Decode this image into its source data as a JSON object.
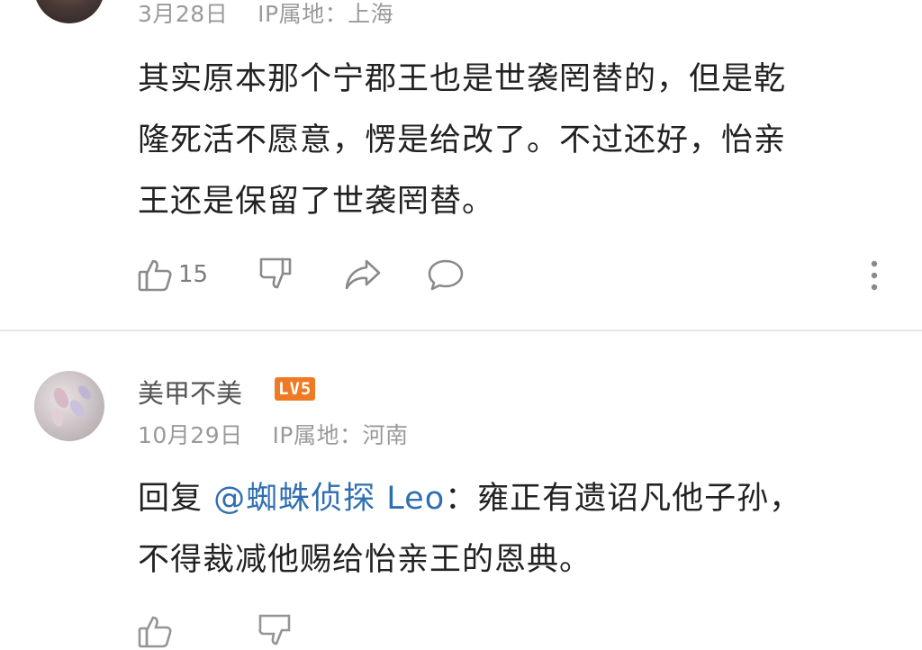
{
  "comment1": {
    "date": "3月28日",
    "ip_label": "IP属地：",
    "ip_location": "上海",
    "lines": [
      "其实原本那个宁郡王也是世袭罔替的，但是乾",
      "隆死活不愿意，愣是给改了。不过还好，怡亲",
      "王还是保留了世袭罔替。"
    ],
    "like_count": "15",
    "icons": [
      "thumbs-up-icon",
      "thumbs-down-icon",
      "share-icon",
      "comment-icon",
      "more-vertical-icon"
    ]
  },
  "comment2": {
    "username": "美甲不美",
    "level": "LV5",
    "date": "10月29日",
    "ip_label": "IP属地：",
    "ip_location": "河南",
    "reply_prefix": "回复",
    "mention": "@蜘蛛侦探 Leo",
    "line1_rest": "：雍正有遗诏凡他子孙，",
    "line2": "不得裁减他赐给怡亲王的恩典。"
  },
  "colors": {
    "text": "#222222",
    "meta": "#9a9a9a",
    "mention": "#2f6fb1",
    "level_badge": "#f07a23",
    "icon": "#8a8a8a",
    "divider": "#e6e6e6"
  }
}
